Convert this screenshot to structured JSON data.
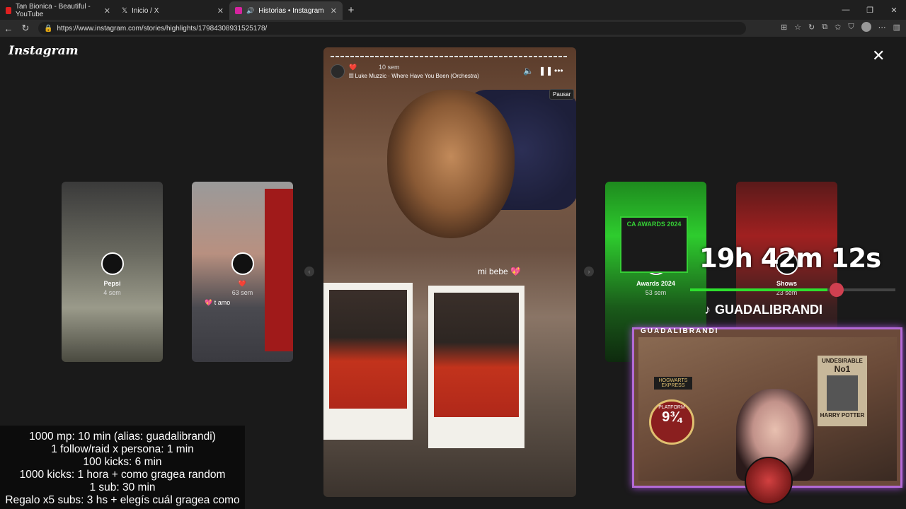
{
  "browser": {
    "tabs": [
      {
        "label": "Tan Bionica - Beautiful - YouTube",
        "favicon_color": "#e02020",
        "active": false
      },
      {
        "label": "Inicio / X",
        "favicon_color": "#dddddd",
        "active": false
      },
      {
        "label": "Historias • Instagram",
        "favicon_color": "#d6249f",
        "active": true
      }
    ],
    "url": "https://www.instagram.com/stories/highlights/17984308931525178/"
  },
  "instagram": {
    "logo": "Instagram",
    "main_story": {
      "time": "10 sem",
      "song": "Luke Muzzic · Where Have You Been (Orchestra)",
      "tooltip": "Pausar",
      "caption": "mi bebe 💖"
    },
    "side_stories": [
      {
        "name": "Pepsi",
        "time": "4 sem"
      },
      {
        "name": "❤️",
        "time": "63 sem",
        "sticker": "💖 t amo"
      },
      {
        "name": "Awards 2024",
        "time": "53 sem"
      },
      {
        "name": "Shows",
        "time": "23 sem"
      }
    ]
  },
  "overlay": {
    "rules": [
      "1000 mp: 10 min (alias: guadalibrandi)",
      "1 follow/raid x persona: 1 min",
      "100 kicks: 6 min",
      "1000 kicks: 1 hora + como gragea random",
      "1 sub: 30 min",
      "Regalo x5 subs: 3 hs + elegís cuál gragea como"
    ],
    "timer": "19h 42m 12s",
    "timer_progress": 0.67,
    "tiktok_handle": "GUADALIBRANDI",
    "cam_label": "GUADALIBRANDI",
    "poster_title": "UNDESIRABLE",
    "poster_no": "No1",
    "poster_name": "HARRY POTTER",
    "roundel_top": "PLATFORM",
    "roundel_num": "9¾",
    "hogwarts_sign": "HOGWARTS EXPRESS",
    "ca_badge": "CA AWARDS 2024"
  }
}
